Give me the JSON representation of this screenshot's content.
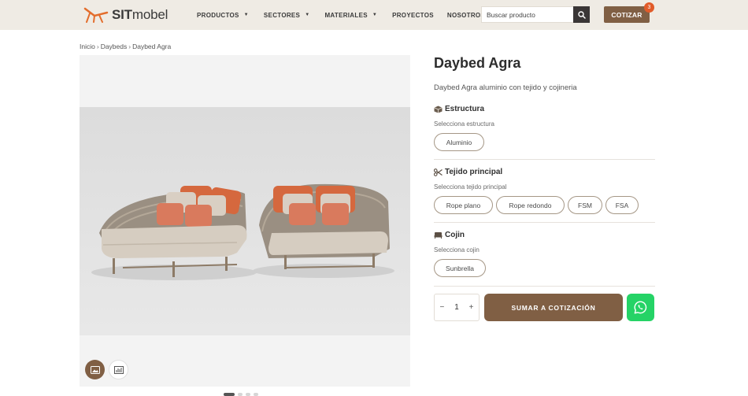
{
  "header": {
    "logo": {
      "bold": "SIT",
      "light": "mobel"
    },
    "nav": [
      {
        "label": "PRODUCTOS",
        "dropdown": true
      },
      {
        "label": "SECTORES",
        "dropdown": true
      },
      {
        "label": "MATERIALES",
        "dropdown": true
      },
      {
        "label": "PROYECTOS",
        "dropdown": false
      },
      {
        "label": "NOSOTROS",
        "dropdown": false
      }
    ],
    "search": {
      "placeholder": "Buscar producto",
      "icon": "search-icon"
    },
    "cotizar_label": "COTIZAR",
    "cart_count": "3"
  },
  "breadcrumb": [
    "Inicio",
    "Daybeds",
    "Daybed Agra"
  ],
  "gallery": {
    "thumb_icons": [
      "image-icon",
      "bar-chart-icon"
    ]
  },
  "product": {
    "title": "Daybed Agra",
    "description": "Daybed Agra aluminio con tejido y cojineria",
    "sections": [
      {
        "icon": "cube-icon",
        "title": "Estructura",
        "subtitle": "Selecciona estructura",
        "options": [
          "Aluminio"
        ]
      },
      {
        "icon": "scissors-icon",
        "title": "Tejido principal",
        "subtitle": "Selecciona tejido principal",
        "options": [
          "Rope plano",
          "Rope redondo",
          "FSM",
          "FSA"
        ]
      },
      {
        "icon": "cushion-icon",
        "title": "Cojin",
        "subtitle": "Selecciona cojin",
        "options": [
          "Sunbrella"
        ]
      }
    ],
    "quantity": {
      "minus": "−",
      "value": "1",
      "plus": "+"
    },
    "add_label": "SUMAR A COTIZACIÓN",
    "whatsapp_icon": "whatsapp-icon"
  },
  "colors": {
    "brand": "#805f44",
    "header_bg": "#efebe4",
    "badge": "#e15b29",
    "whatsapp": "#25d366"
  }
}
